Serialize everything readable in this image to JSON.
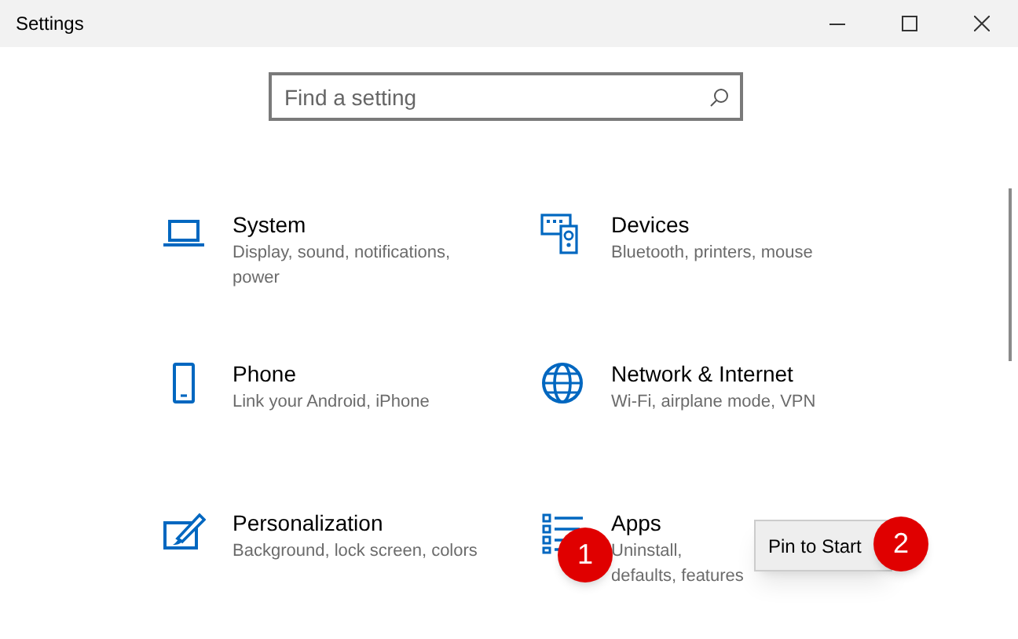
{
  "window": {
    "title": "Settings"
  },
  "search": {
    "placeholder": "Find a setting"
  },
  "categories": [
    {
      "kind": "laptop",
      "title": "System",
      "description": "Display, sound, notifications, power"
    },
    {
      "kind": "devices",
      "title": "Devices",
      "description": "Bluetooth, printers, mouse"
    },
    {
      "kind": "phone",
      "title": "Phone",
      "description": "Link your Android, iPhone"
    },
    {
      "kind": "globe",
      "title": "Network & Internet",
      "description": "Wi-Fi, airplane mode, VPN"
    },
    {
      "kind": "brush",
      "title": "Personalization",
      "description": "Background, lock screen, colors"
    },
    {
      "kind": "list",
      "title": "Apps",
      "description": "Uninstall, defaults, features"
    }
  ],
  "context_menu": {
    "items": [
      "Pin to Start"
    ]
  },
  "step_markers": [
    "1",
    "2"
  ]
}
